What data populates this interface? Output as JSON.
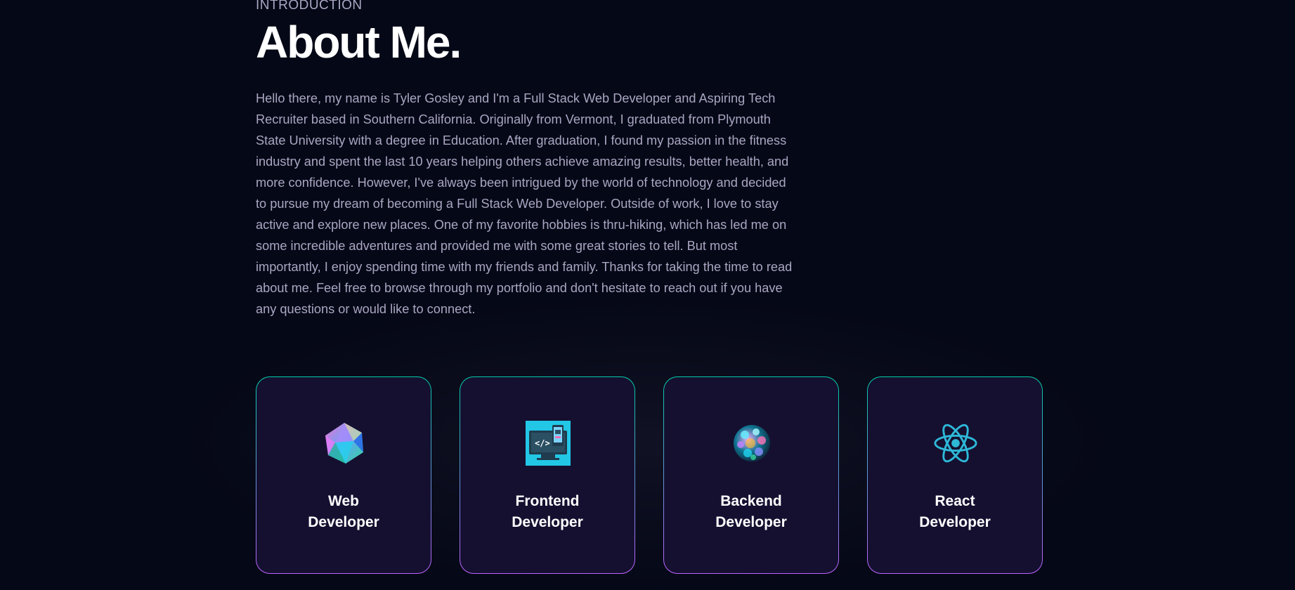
{
  "header": {
    "overline": "Introduction",
    "title": "About Me."
  },
  "bio": "Hello there, my name is Tyler Gosley and I'm a Full Stack Web Developer and Aspiring Tech Recruiter based in Southern California. Originally from Vermont, I graduated from Plymouth State University with a degree in Education. After graduation, I found my passion in the fitness industry and spent the last 10 years helping others achieve amazing results, better health, and more confidence. However, I've always been intrigued by the world of technology and decided to pursue my dream of becoming a Full Stack Web Developer. Outside of work, I love to stay active and explore new places. One of my favorite hobbies is thru-hiking, which has led me on some incredible adventures and provided me with some great stories to tell. But most importantly, I enjoy spending time with my friends and family. Thanks for taking the time to read about me. Feel free to browse through my portfolio and don't hesitate to reach out if you have any questions or would like to connect.",
  "cards": [
    {
      "line1": "Web",
      "line2": "Developer",
      "icon": "crystal-gem-icon"
    },
    {
      "line1": "Frontend",
      "line2": "Developer",
      "icon": "code-monitor-icon"
    },
    {
      "line1": "Backend",
      "line2": "Developer",
      "icon": "sphere-cluster-icon"
    },
    {
      "line1": "React",
      "line2": "Developer",
      "icon": "react-atom-icon"
    }
  ],
  "colors": {
    "background": "#050816",
    "card_bg": "#151030",
    "border_top": "#00cea8",
    "border_bottom": "#bf61ff",
    "secondary_text": "#aaa6c3",
    "react_cyan": "#38bdf8"
  }
}
